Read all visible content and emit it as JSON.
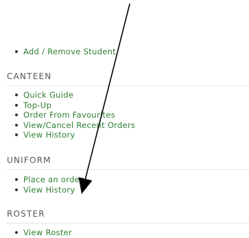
{
  "top_links": [
    {
      "label": "Add / Remove Student"
    }
  ],
  "sections": [
    {
      "heading": "CANTEEN",
      "links": [
        {
          "label": "Quick Guide"
        },
        {
          "label": "Top-Up"
        },
        {
          "label": "Order From Favourites"
        },
        {
          "label": "View/Cancel Recent Orders"
        },
        {
          "label": "View History"
        }
      ]
    },
    {
      "heading": "UNIFORM",
      "links": [
        {
          "label": "Place an order"
        },
        {
          "label": "View History"
        }
      ]
    },
    {
      "heading": "ROSTER",
      "links": [
        {
          "label": "View Roster"
        }
      ]
    }
  ],
  "colors": {
    "link": "#2e7d32",
    "heading": "#555555",
    "arrow": "#000000"
  }
}
